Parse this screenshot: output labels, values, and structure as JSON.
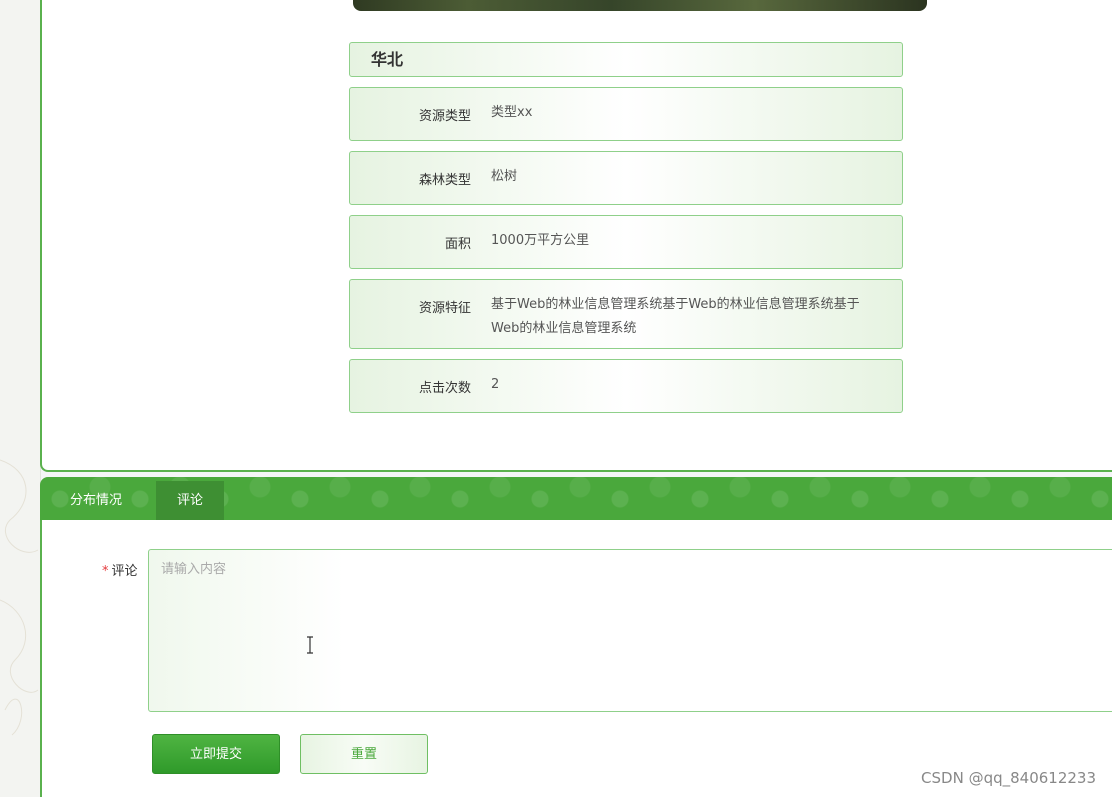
{
  "detail": {
    "region": "华北",
    "rows": [
      {
        "label": "资源类型",
        "value": "类型xx"
      },
      {
        "label": "森林类型",
        "value": "松树"
      },
      {
        "label": "面积",
        "value": "1000万平方公里"
      },
      {
        "label": "资源特征",
        "value": "基于Web的林业信息管理系统基于Web的林业信息管理系统基于Web的林业信息管理系统"
      },
      {
        "label": "点击次数",
        "value": "2"
      }
    ]
  },
  "tabs": [
    {
      "label": "分布情况",
      "active": false
    },
    {
      "label": "评论",
      "active": true
    }
  ],
  "comment_form": {
    "required_mark": "*",
    "label": "评论",
    "placeholder": "请输入内容",
    "submit_label": "立即提交",
    "reset_label": "重置"
  },
  "watermark": "CSDN @qq_840612233",
  "colors": {
    "accent": "#4aa83c",
    "border": "#8fd08a",
    "required": "#e4393c"
  }
}
